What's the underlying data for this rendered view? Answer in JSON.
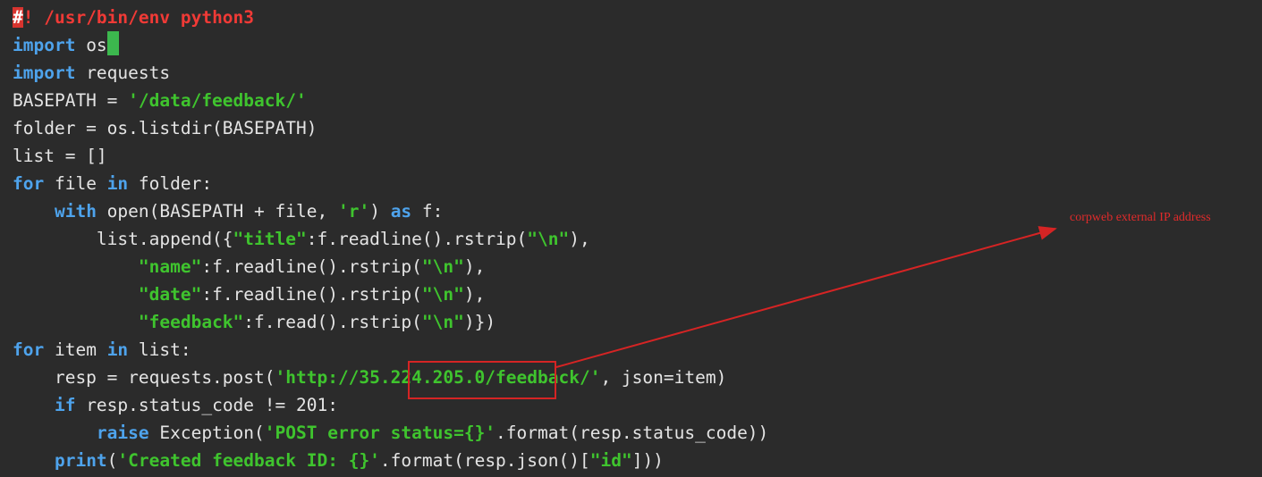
{
  "code": {
    "lines": [
      [
        {
          "t": "#",
          "c": "t-shebg"
        },
        {
          "t": "! /usr/bin/env python3",
          "c": "t-she"
        }
      ],
      [
        {
          "t": "import",
          "c": "t-kw"
        },
        {
          "t": " os",
          "c": "t-pl"
        }
      ],
      [
        {
          "t": "import",
          "c": "t-kw"
        },
        {
          "t": " requests",
          "c": "t-pl"
        }
      ],
      [
        {
          "t": "BASEPATH = ",
          "c": "t-pl"
        },
        {
          "t": "'/data/feedback/'",
          "c": "t-str"
        }
      ],
      [
        {
          "t": "folder = os.listdir(BASEPATH)",
          "c": "t-pl"
        }
      ],
      [
        {
          "t": "list = []",
          "c": "t-pl"
        }
      ],
      [
        {
          "t": "for",
          "c": "t-kw"
        },
        {
          "t": " file ",
          "c": "t-pl"
        },
        {
          "t": "in",
          "c": "t-kw"
        },
        {
          "t": " folder:",
          "c": "t-pl"
        }
      ],
      [
        {
          "t": "    ",
          "c": "t-pl"
        },
        {
          "t": "with",
          "c": "t-kw"
        },
        {
          "t": " open(BASEPATH + file, ",
          "c": "t-pl"
        },
        {
          "t": "'r'",
          "c": "t-str"
        },
        {
          "t": ") ",
          "c": "t-pl"
        },
        {
          "t": "as",
          "c": "t-kw"
        },
        {
          "t": " f:",
          "c": "t-pl"
        }
      ],
      [
        {
          "t": "        list.append({",
          "c": "t-pl"
        },
        {
          "t": "\"title\"",
          "c": "t-str"
        },
        {
          "t": ":f.readline().rstrip(",
          "c": "t-pl"
        },
        {
          "t": "\"\\n\"",
          "c": "t-str"
        },
        {
          "t": "),",
          "c": "t-pl"
        }
      ],
      [
        {
          "t": "            ",
          "c": "t-pl"
        },
        {
          "t": "\"name\"",
          "c": "t-str"
        },
        {
          "t": ":f.readline().rstrip(",
          "c": "t-pl"
        },
        {
          "t": "\"\\n\"",
          "c": "t-str"
        },
        {
          "t": "),",
          "c": "t-pl"
        }
      ],
      [
        {
          "t": "            ",
          "c": "t-pl"
        },
        {
          "t": "\"date\"",
          "c": "t-str"
        },
        {
          "t": ":f.readline().rstrip(",
          "c": "t-pl"
        },
        {
          "t": "\"\\n\"",
          "c": "t-str"
        },
        {
          "t": "),",
          "c": "t-pl"
        }
      ],
      [
        {
          "t": "            ",
          "c": "t-pl"
        },
        {
          "t": "\"feedback\"",
          "c": "t-str"
        },
        {
          "t": ":f.read().rstrip(",
          "c": "t-pl"
        },
        {
          "t": "\"\\n\"",
          "c": "t-str"
        },
        {
          "t": ")})",
          "c": "t-pl"
        }
      ],
      [
        {
          "t": "for",
          "c": "t-kw"
        },
        {
          "t": " item ",
          "c": "t-pl"
        },
        {
          "t": "in",
          "c": "t-kw"
        },
        {
          "t": " list:",
          "c": "t-pl"
        }
      ],
      [
        {
          "t": "    resp = requests.post(",
          "c": "t-pl"
        },
        {
          "t": "'http://35.224.205.0/feedback/'",
          "c": "t-str"
        },
        {
          "t": ", json=item)",
          "c": "t-pl"
        }
      ],
      [
        {
          "t": "    ",
          "c": "t-pl"
        },
        {
          "t": "if",
          "c": "t-kw"
        },
        {
          "t": " resp.status_code != 201:",
          "c": "t-pl"
        }
      ],
      [
        {
          "t": "        ",
          "c": "t-pl"
        },
        {
          "t": "raise",
          "c": "t-kw"
        },
        {
          "t": " Exception(",
          "c": "t-pl"
        },
        {
          "t": "'POST error status={}'",
          "c": "t-str"
        },
        {
          "t": ".format(resp.status_code))",
          "c": "t-pl"
        }
      ],
      [
        {
          "t": "    ",
          "c": "t-pl"
        },
        {
          "t": "print",
          "c": "t-kw"
        },
        {
          "t": "(",
          "c": "t-pl"
        },
        {
          "t": "'Created feedback ID: {}'",
          "c": "t-str"
        },
        {
          "t": ".format(resp.json()[",
          "c": "t-pl"
        },
        {
          "t": "\"id\"",
          "c": "t-str"
        },
        {
          "t": "]))",
          "c": "t-pl"
        }
      ]
    ],
    "cursor_line": 1
  },
  "annotation": {
    "label": "corpweb external IP address",
    "color": "#e02b2b"
  },
  "colors": {
    "background": "#2b2b2b",
    "keyword": "#4ea3ec",
    "string": "#3fc42e",
    "plain": "#e4e4e4",
    "cursor": "#3cb84e"
  }
}
